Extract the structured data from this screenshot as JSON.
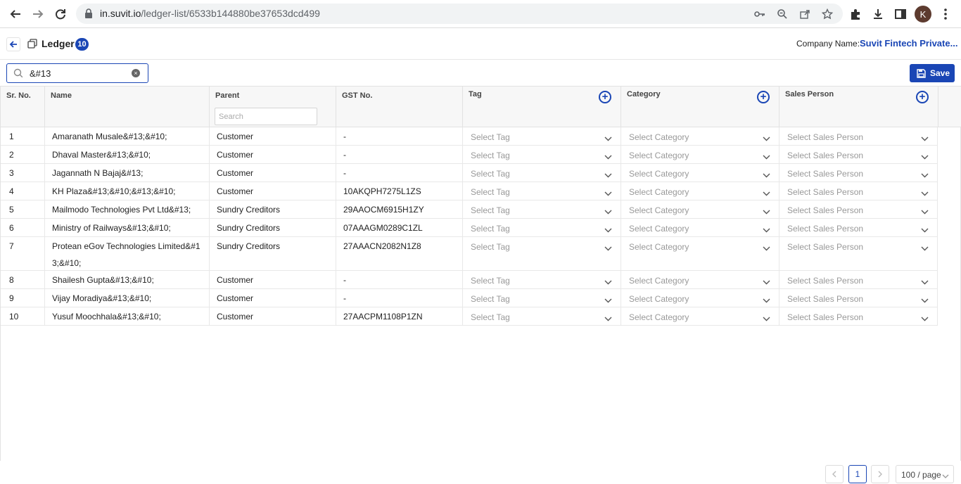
{
  "browser": {
    "url_host": "in.suvit.io",
    "url_path": "/ledger-list/6533b144880be37653dcd499",
    "avatar_letter": "K"
  },
  "header": {
    "title": "Ledger",
    "count": "10",
    "company_label": "Company Name:",
    "company_value": "Suvit Fintech Private..."
  },
  "toolbar": {
    "search_value": "&#13",
    "save_label": "Save"
  },
  "columns": {
    "sr": "Sr. No.",
    "name": "Name",
    "parent": "Parent",
    "parent_search_placeholder": "Search",
    "gst": "GST No.",
    "tag": "Tag",
    "category": "Category",
    "sales": "Sales Person"
  },
  "placeholders": {
    "tag": "Select Tag",
    "category": "Select Category",
    "sales": "Select Sales Person"
  },
  "rows": [
    {
      "sr": "1",
      "name": "Amaranath Musale&#13;&#10;",
      "parent": "Customer",
      "gst": "-"
    },
    {
      "sr": "2",
      "name": "Dhaval Master&#13;&#10;",
      "parent": "Customer",
      "gst": "-"
    },
    {
      "sr": "3",
      "name": "Jagannath N Bajaj&#13;",
      "parent": "Customer",
      "gst": "-"
    },
    {
      "sr": "4",
      "name": "KH Plaza&#13;&#10;&#13;&#10;",
      "parent": "Customer",
      "gst": "10AKQPH7275L1ZS"
    },
    {
      "sr": "5",
      "name": "Mailmodo Technologies Pvt Ltd&#13;",
      "parent": "Sundry Creditors",
      "gst": "29AAOCM6915H1ZY"
    },
    {
      "sr": "6",
      "name": "Ministry of Railways&#13;&#10;",
      "parent": "Sundry Creditors",
      "gst": "07AAAGM0289C1ZL"
    },
    {
      "sr": "7",
      "name": "Protean eGov Technologies Limited&#13;&#10;",
      "parent": "Sundry Creditors",
      "gst": "27AAACN2082N1Z8"
    },
    {
      "sr": "8",
      "name": "Shailesh Gupta&#13;&#10;",
      "parent": "Customer",
      "gst": "-"
    },
    {
      "sr": "9",
      "name": "Vijay Moradiya&#13;&#10;",
      "parent": "Customer",
      "gst": "-"
    },
    {
      "sr": "10",
      "name": "Yusuf Moochhala&#13;&#10;",
      "parent": "Customer",
      "gst": "27AACPM1108P1ZN"
    }
  ],
  "pagination": {
    "prev": "<",
    "current_page": "1",
    "next": ">",
    "page_size": "100 / page"
  },
  "colors": {
    "accent": "#1a46b5"
  }
}
